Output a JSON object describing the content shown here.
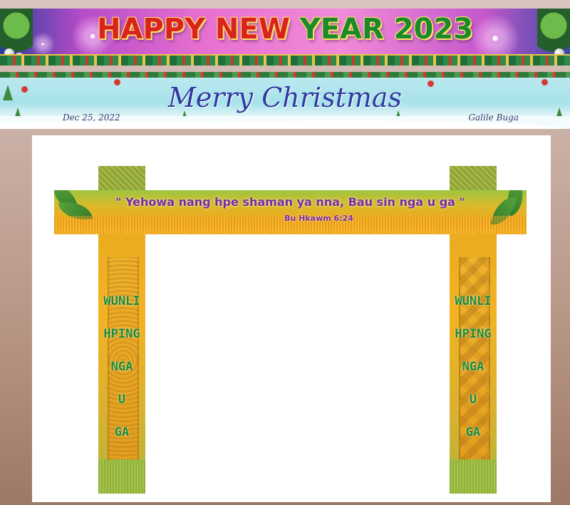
{
  "banner_new_year": {
    "title_red": "HAPPY NEW ",
    "title_green": "YEAR",
    "title_year": " 2023"
  },
  "banner_christmas": {
    "title": "Merry Christmas",
    "date": "Dec 25, 2022",
    "name": "Galile Buga"
  },
  "gate": {
    "verse": "\" Yehowa nang hpe shaman ya nna, Bau sin nga u ga \"",
    "verse_ref": "Bu Hkawm 6:24",
    "left_pillar": [
      "WUNLI",
      "HPING",
      "NGA",
      "U",
      "GA"
    ],
    "right_pillar": [
      "WUNLI",
      "HPING",
      "NGA",
      "U",
      "GA"
    ]
  },
  "colors": {
    "verse_text": "#7a2aa8",
    "pillar_text": "#1c8a3a",
    "christmas_title": "#2f3aa2",
    "new_year_red": "#d8231f",
    "new_year_green": "#1b8a2c"
  }
}
